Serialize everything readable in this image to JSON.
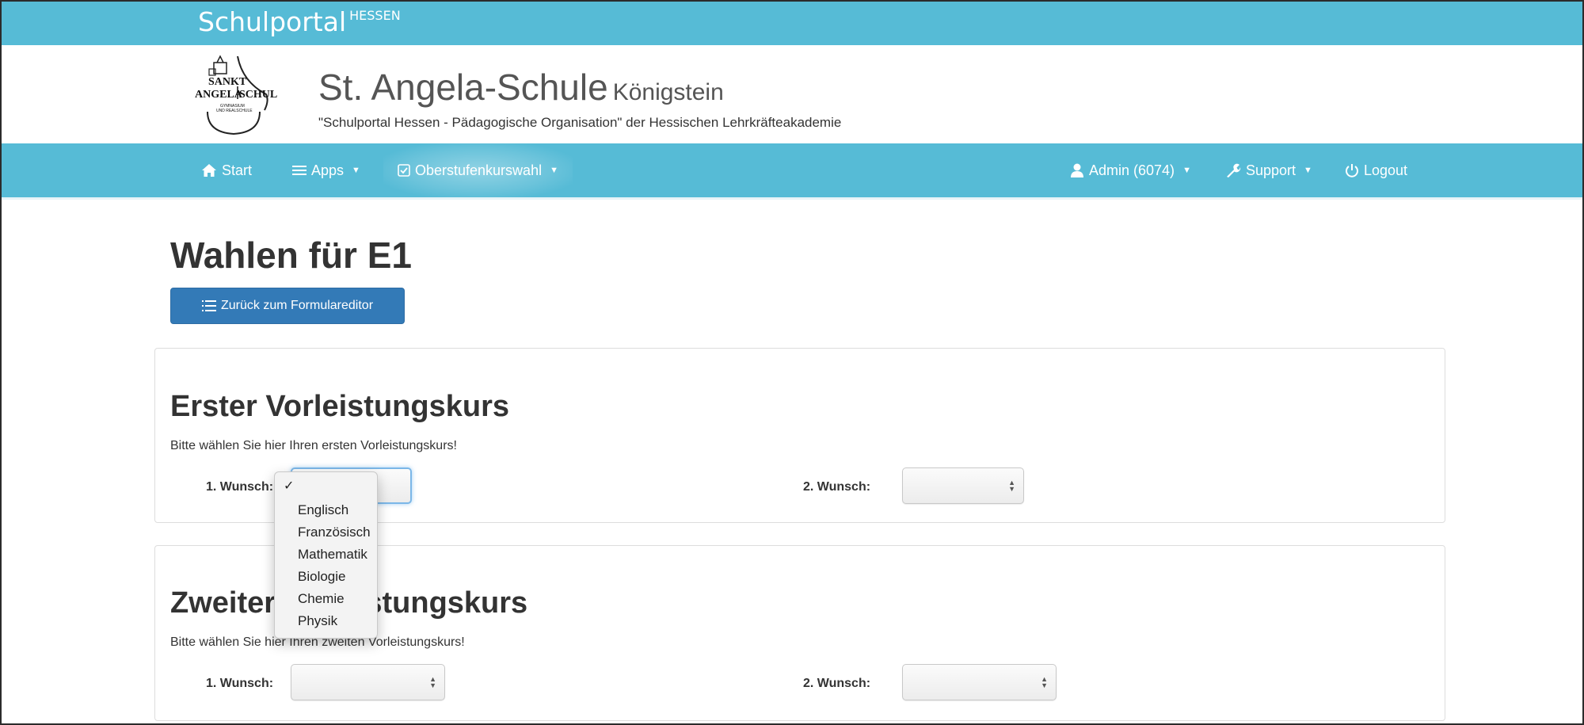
{
  "portal": {
    "brand": "Schulportal",
    "brand_sup": "HESSEN"
  },
  "school": {
    "name": "St. Angela-Schule",
    "town": "Königstein",
    "subtitle": "\"Schulportal Hessen - Pädagogische Organisation\" der Hessischen Lehrkräfteakademie",
    "logo": {
      "line1": "SANKT",
      "line2": "ANGELA",
      "line3": "SCHULE",
      "small1": "GYMNASIUM",
      "small2": "UND REALSCHULE"
    }
  },
  "nav": {
    "start": "Start",
    "apps": "Apps",
    "oberstufe": "Oberstufenkurswahl",
    "admin": "Admin (6074)",
    "support": "Support",
    "logout": "Logout"
  },
  "page": {
    "title": "Wahlen für E1",
    "back_button": "Zurück zum Formulareditor"
  },
  "sections": [
    {
      "heading": "Erster Vorleistungskurs",
      "text": "Bitte wählen Sie hier Ihren ersten Vorleistungskurs!",
      "wish1_label": "1. Wunsch:",
      "wish2_label": "2. Wunsch:",
      "wish1_value": "",
      "wish2_value": ""
    },
    {
      "heading": "Zweiter Vorleistungskurs",
      "text": "Bitte wählen Sie hier Ihren zweiten Vorleistungskurs!",
      "wish1_label": "1. Wunsch:",
      "wish2_label": "2. Wunsch:",
      "wish1_value": "",
      "wish2_value": ""
    }
  ],
  "dropdown": {
    "selected_mark": "✓",
    "options": [
      "Englisch",
      "Französisch",
      "Mathematik",
      "Biologie",
      "Chemie",
      "Physik"
    ]
  },
  "colors": {
    "bar": "#56bbd6",
    "button": "#337ab7"
  },
  "icons": [
    "home-icon",
    "menu-icon",
    "checkbox-icon",
    "user-icon",
    "wrench-icon",
    "power-icon",
    "list-icon"
  ]
}
